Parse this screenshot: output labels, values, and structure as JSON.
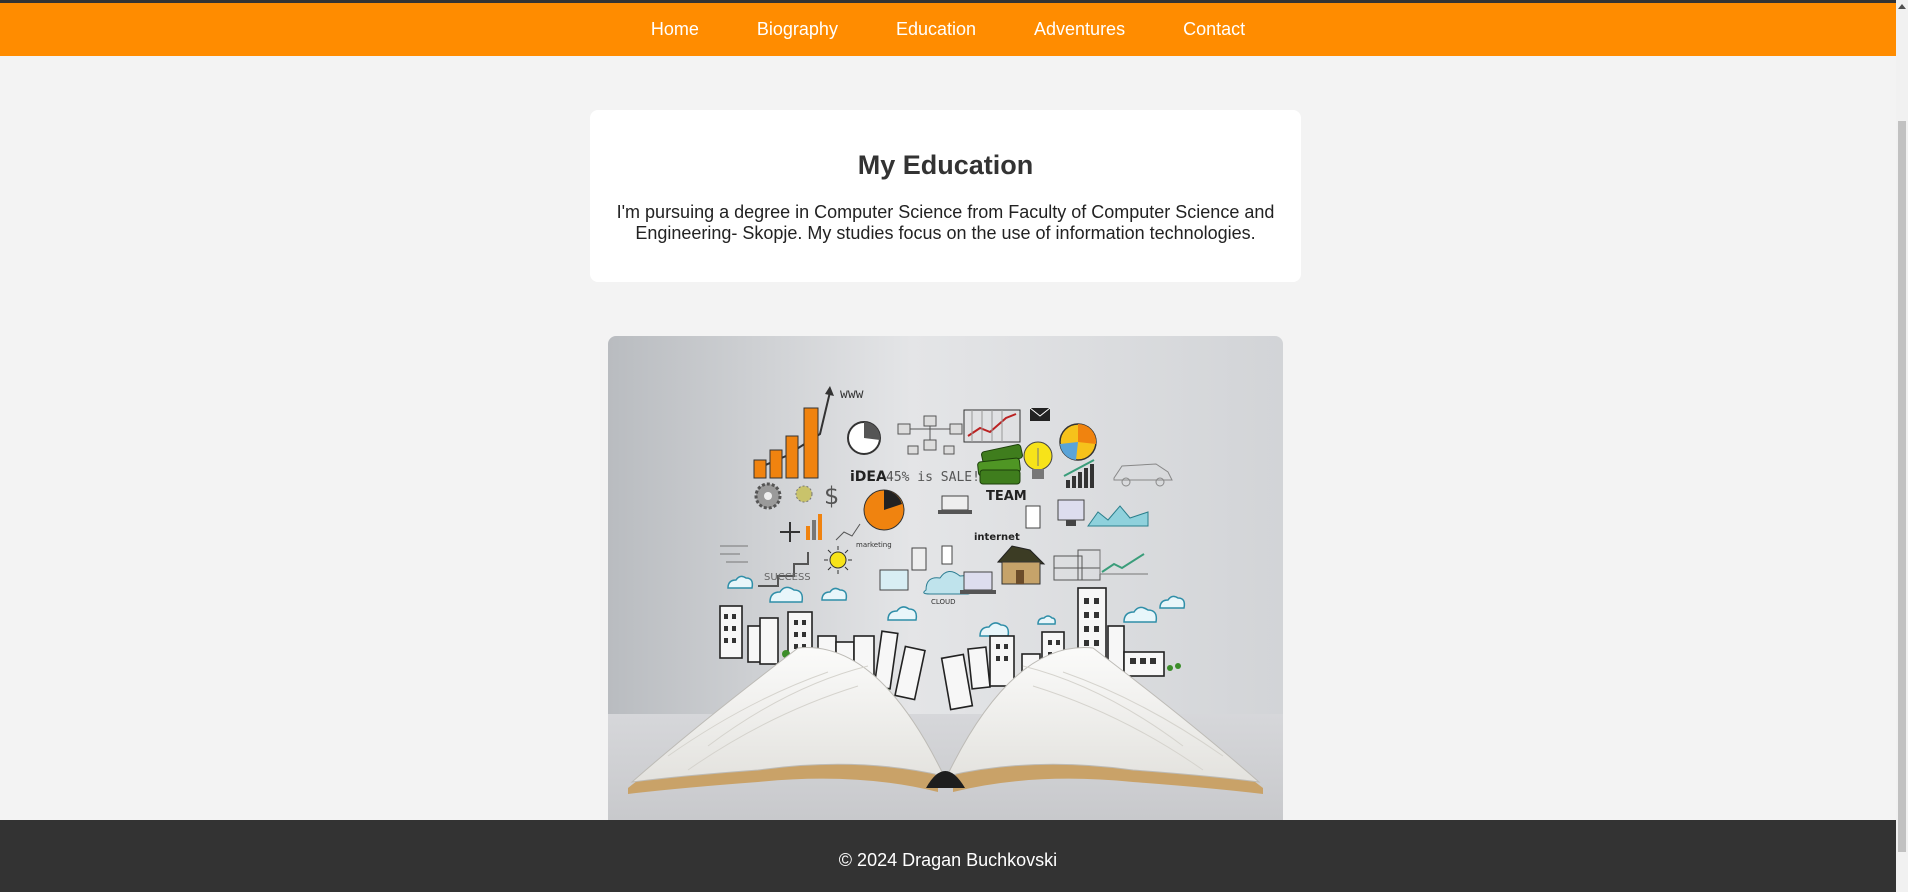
{
  "nav": {
    "items": [
      {
        "label": "Home"
      },
      {
        "label": "Biography"
      },
      {
        "label": "Education"
      },
      {
        "label": "Adventures"
      },
      {
        "label": "Contact"
      }
    ]
  },
  "education": {
    "title": "My Education",
    "description": "I'm pursuing a degree in Computer Science from Faculty of Computer Science and Engineering- Skopje. My studies focus on the use of information technologies."
  },
  "hero_image": {
    "handwritten_labels": [
      "www",
      "iDEA",
      "45% is SALE!",
      "TEAM",
      "internet",
      "SUCCESS",
      "CLOUD",
      "marketing"
    ]
  },
  "footer": {
    "copyright": "© 2024 Dragan Buchkovski"
  },
  "colors": {
    "nav_bg": "#ff8c00",
    "page_bg": "#f3f3f3",
    "footer_bg": "#333333",
    "card_bg": "#ffffff"
  }
}
